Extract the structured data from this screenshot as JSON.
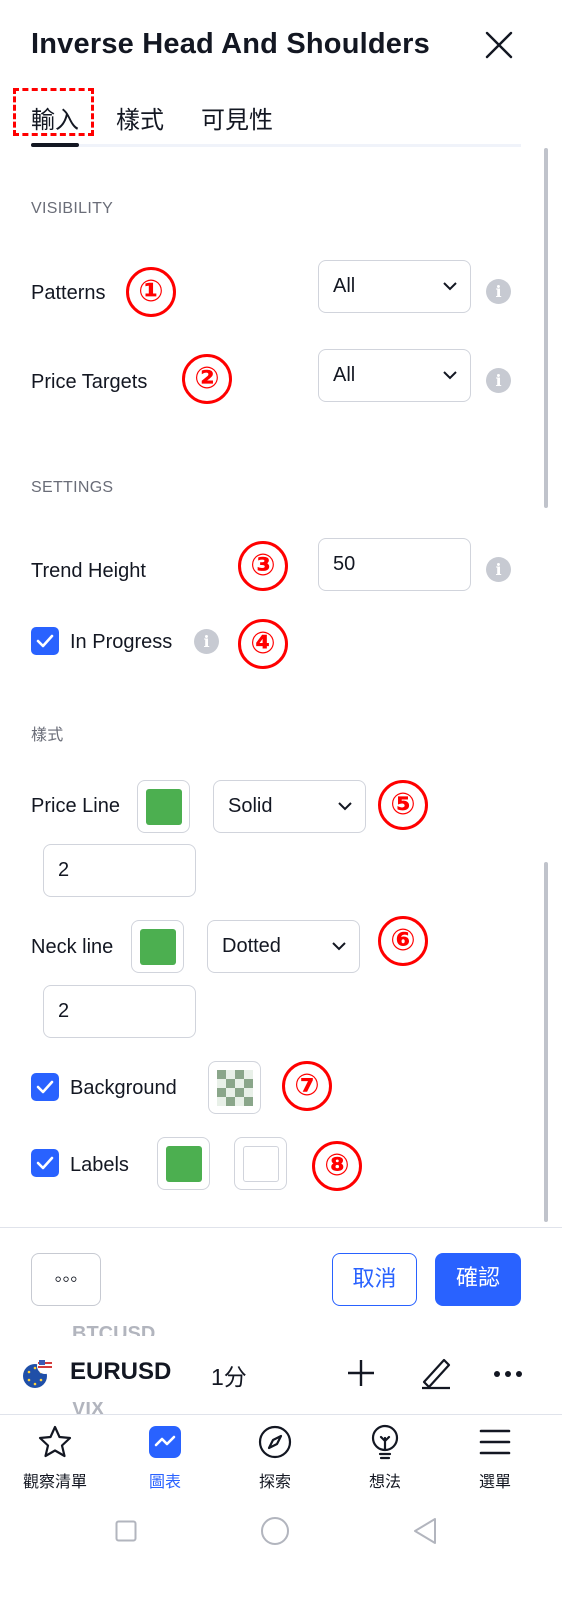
{
  "dialog": {
    "title": "Inverse Head And Shoulders",
    "tabs": [
      "輸入",
      "樣式",
      "可見性"
    ],
    "active_tab": "輸入"
  },
  "visibility": {
    "section_label": "VISIBILITY",
    "patterns": {
      "label": "Patterns",
      "value": "All"
    },
    "price_targets": {
      "label": "Price Targets",
      "value": "All"
    }
  },
  "settings": {
    "section_label": "SETTINGS",
    "trend_height": {
      "label": "Trend Height",
      "value": "50"
    },
    "in_progress": {
      "label": "In Progress",
      "checked": true
    }
  },
  "style": {
    "section_label": "樣式",
    "price_line": {
      "label": "Price Line",
      "color": "#4caf50",
      "line_style": "Solid",
      "width": "2"
    },
    "neck_line": {
      "label": "Neck line",
      "color": "#4caf50",
      "line_style": "Dotted",
      "width": "2"
    },
    "background": {
      "label": "Background",
      "checked": true
    },
    "labels": {
      "label": "Labels",
      "checked": true,
      "color": "#4caf50",
      "text_color": "#ffffff"
    }
  },
  "annotations": [
    "①",
    "②",
    "③",
    "④",
    "⑤",
    "⑥",
    "⑦",
    "⑧"
  ],
  "footer": {
    "more_label": "◦◦◦",
    "cancel_label": "取消",
    "ok_label": "確認"
  },
  "chart_bar": {
    "symbol": "EURUSD",
    "interval": "1分",
    "ghost_above": "BTCUSD",
    "ghost_below": "VIX"
  },
  "bottom_nav": {
    "items": [
      {
        "label": "觀察清單",
        "icon": "star-icon"
      },
      {
        "label": "圖表",
        "icon": "chart-icon"
      },
      {
        "label": "探索",
        "icon": "compass-icon"
      },
      {
        "label": "想法",
        "icon": "lightbulb-icon"
      },
      {
        "label": "選單",
        "icon": "menu-icon"
      }
    ],
    "active": "圖表"
  },
  "colors": {
    "accent": "#2962ff",
    "annotation_red": "#ff0000",
    "swatch_green": "#4caf50"
  }
}
